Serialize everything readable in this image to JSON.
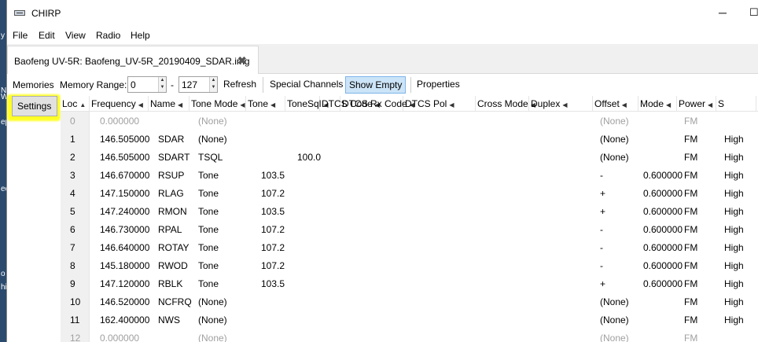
{
  "window": {
    "title": "CHIRP"
  },
  "menu": [
    "File",
    "Edit",
    "View",
    "Radio",
    "Help"
  ],
  "tab": {
    "label": "Baofeng UV-5R: Baofeng_UV-5R_20190409_SDAR.img"
  },
  "toolbar": {
    "memories": "Memories",
    "memory_range_label": "Memory Range:",
    "range_start": "0",
    "range_dash": "-",
    "range_end": "127",
    "refresh": "Refresh",
    "special_channels": "Special Channels",
    "show_empty": "Show Empty",
    "properties": "Properties"
  },
  "sidebar": {
    "settings": "Settings"
  },
  "grid": {
    "columns": [
      "Loc",
      "Frequency",
      "Name",
      "Tone Mode",
      "Tone",
      "ToneSql",
      "DTCS Code",
      "DTCS Rx Code",
      "DTCS Pol",
      "Cross Mode",
      "Duplex",
      "Offset",
      "Mode",
      "Power",
      "S"
    ],
    "rows": [
      {
        "loc": "0",
        "freq": "0.000000",
        "name": "",
        "tmode": "(None)",
        "tone": "",
        "tsql": "",
        "duplex": "(None)",
        "offset": "",
        "mode": "FM",
        "power": "",
        "empty": true
      },
      {
        "loc": "1",
        "freq": "146.505000",
        "name": "SDAR",
        "tmode": "(None)",
        "tone": "",
        "tsql": "",
        "duplex": "(None)",
        "offset": "",
        "mode": "FM",
        "power": "High",
        "empty": false
      },
      {
        "loc": "2",
        "freq": "146.505000",
        "name": "SDART",
        "tmode": "TSQL",
        "tone": "",
        "tsql": "100.0",
        "duplex": "(None)",
        "offset": "",
        "mode": "FM",
        "power": "High",
        "empty": false
      },
      {
        "loc": "3",
        "freq": "146.670000",
        "name": "RSUP",
        "tmode": "Tone",
        "tone": "103.5",
        "tsql": "",
        "duplex": "-",
        "offset": "0.600000",
        "mode": "FM",
        "power": "High",
        "empty": false
      },
      {
        "loc": "4",
        "freq": "147.150000",
        "name": "RLAG",
        "tmode": "Tone",
        "tone": "107.2",
        "tsql": "",
        "duplex": "+",
        "offset": "0.600000",
        "mode": "FM",
        "power": "High",
        "empty": false
      },
      {
        "loc": "5",
        "freq": "147.240000",
        "name": "RMON",
        "tmode": "Tone",
        "tone": "103.5",
        "tsql": "",
        "duplex": "+",
        "offset": "0.600000",
        "mode": "FM",
        "power": "High",
        "empty": false
      },
      {
        "loc": "6",
        "freq": "146.730000",
        "name": "RPAL",
        "tmode": "Tone",
        "tone": "107.2",
        "tsql": "",
        "duplex": "-",
        "offset": "0.600000",
        "mode": "FM",
        "power": "High",
        "empty": false
      },
      {
        "loc": "7",
        "freq": "146.640000",
        "name": "ROTAY",
        "tmode": "Tone",
        "tone": "107.2",
        "tsql": "",
        "duplex": "-",
        "offset": "0.600000",
        "mode": "FM",
        "power": "High",
        "empty": false
      },
      {
        "loc": "8",
        "freq": "145.180000",
        "name": "RWOD",
        "tmode": "Tone",
        "tone": "107.2",
        "tsql": "",
        "duplex": "-",
        "offset": "0.600000",
        "mode": "FM",
        "power": "High",
        "empty": false
      },
      {
        "loc": "9",
        "freq": "147.120000",
        "name": "RBLK",
        "tmode": "Tone",
        "tone": "103.5",
        "tsql": "",
        "duplex": "+",
        "offset": "0.600000",
        "mode": "FM",
        "power": "High",
        "empty": false
      },
      {
        "loc": "10",
        "freq": "146.520000",
        "name": "NCFRQ",
        "tmode": "(None)",
        "tone": "",
        "tsql": "",
        "duplex": "(None)",
        "offset": "",
        "mode": "FM",
        "power": "High",
        "empty": false
      },
      {
        "loc": "11",
        "freq": "162.400000",
        "name": "NWS",
        "tmode": "(None)",
        "tone": "",
        "tsql": "",
        "duplex": "(None)",
        "offset": "",
        "mode": "FM",
        "power": "High",
        "empty": false
      },
      {
        "loc": "12",
        "freq": "0.000000",
        "name": "",
        "tmode": "(None)",
        "tone": "",
        "tsql": "",
        "duplex": "(None)",
        "offset": "",
        "mode": "FM",
        "power": "",
        "empty": true
      }
    ]
  },
  "desktop_strip": [
    "y",
    "N",
    "ep",
    "W",
    "ee",
    "o",
    "hi"
  ]
}
